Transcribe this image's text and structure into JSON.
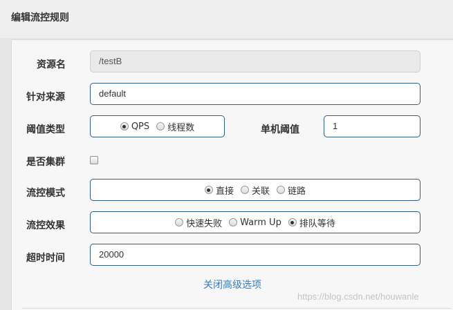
{
  "dialog": {
    "title": "编辑流控规则"
  },
  "form": {
    "resource": {
      "label": "资源名",
      "value": "/testB"
    },
    "limit_app": {
      "label": "针对来源",
      "value": "default"
    },
    "threshold_type": {
      "label": "阈值类型",
      "options": [
        {
          "label": "QPS",
          "checked": true
        },
        {
          "label": "线程数",
          "checked": false
        }
      ]
    },
    "threshold": {
      "label": "单机阈值",
      "value": "1"
    },
    "cluster": {
      "label": "是否集群",
      "checked": false
    },
    "strategy": {
      "label": "流控模式",
      "options": [
        {
          "label": "直接",
          "checked": true
        },
        {
          "label": "关联",
          "checked": false
        },
        {
          "label": "链路",
          "checked": false
        }
      ]
    },
    "control_behavior": {
      "label": "流控效果",
      "options": [
        {
          "label": "快速失败",
          "checked": false
        },
        {
          "label": "Warm Up",
          "checked": false
        },
        {
          "label": "排队等待",
          "checked": true
        }
      ]
    },
    "timeout": {
      "label": "超时时间",
      "value": "20000"
    },
    "advanced_toggle": "关闭高级选项"
  },
  "watermark": "https://blog.csdn.net/houwanle"
}
